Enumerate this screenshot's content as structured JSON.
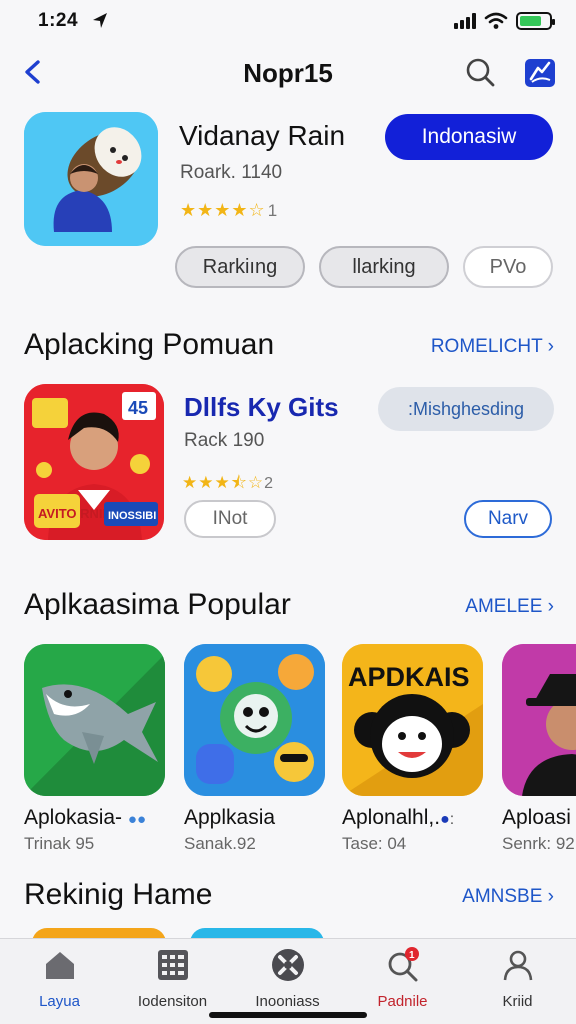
{
  "status_bar": {
    "time": "1:24",
    "battery_level": 0.75,
    "colors": {
      "battery": "#35c759"
    }
  },
  "nav": {
    "title": "Nopr15",
    "back_icon": "chevron-left-icon",
    "search_icon": "search-icon",
    "promo_icon": "hand-badge-icon",
    "accent": "#1e3fd0"
  },
  "featured": {
    "name": "Vidanay Rain",
    "rank": "Roark.  1140",
    "rating": 4,
    "rating_count": "1",
    "cta_label": "Indonasiw",
    "cta_color": "#1220d8",
    "pills": [
      "Rarkiıng",
      "Ɩlarking",
      "PVo"
    ]
  },
  "section1": {
    "title": "Aplacking Pomuan",
    "link": "ROMELICHT"
  },
  "list_app": {
    "name": "Dllfs Ky Gits",
    "rank": "Rack     190",
    "rating": 3.5,
    "rating_count": "2",
    "install_label": "INot",
    "tag_label": ":Mishghesding",
    "new_label": "Narv",
    "tile_text": "AVITO RNIE",
    "badge_text": "INOSSIBI"
  },
  "section2": {
    "title": "Aplkaasima Popular",
    "link": "AMELEE"
  },
  "popular": [
    {
      "name": "Aplokasia-",
      "sub": "Trinak  95",
      "icon": "shark-icon",
      "color": "#26a848"
    },
    {
      "name": "Applkasia",
      "sub": "Sanak.92",
      "icon": "emoji-faces-icon",
      "color": "#2a8ee0"
    },
    {
      "name": "Aplonalhl,.",
      "sub": "Tase: 04",
      "icon": "monkey-icon",
      "color": "#f4b51a",
      "tile_text": "APDKAIS"
    },
    {
      "name": "Aploasi",
      "sub": "Senrk: 92",
      "icon": "person-hat-icon",
      "color": "#c13aa8"
    }
  ],
  "section3": {
    "title": "Rekinig Hame",
    "link": "AMNSBE"
  },
  "tabs": [
    {
      "label": "Layua",
      "icon": "home-icon"
    },
    {
      "label": "Iodensiton",
      "icon": "grid-icon"
    },
    {
      "label": "Inooniass",
      "icon": "tools-icon"
    },
    {
      "label": "Padnile",
      "icon": "search-alert-icon"
    },
    {
      "label": "Kriid",
      "icon": "profile-icon"
    }
  ],
  "tab_alert_count": "1"
}
